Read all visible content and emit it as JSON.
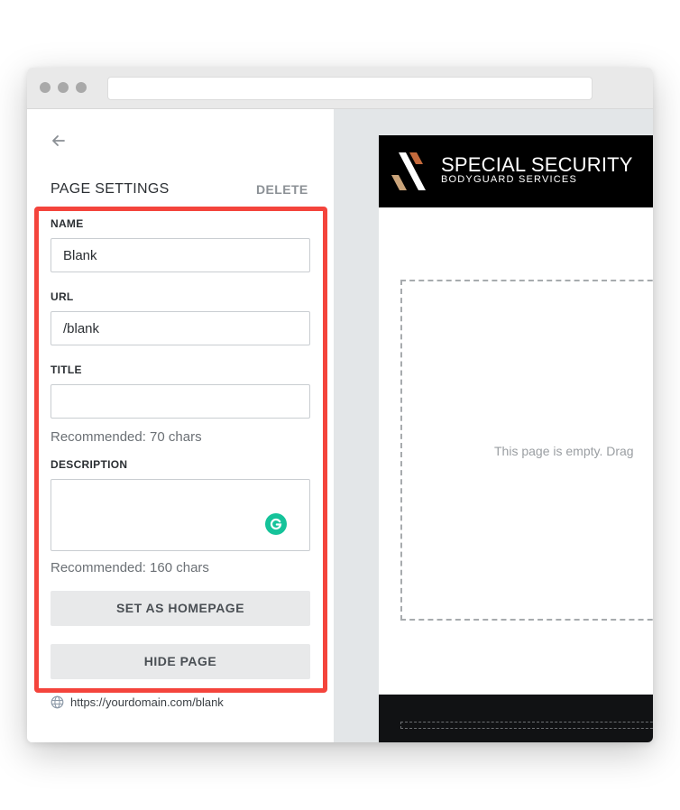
{
  "panel": {
    "title": "PAGE SETTINGS",
    "delete_label": "DELETE",
    "name_label": "NAME",
    "name_value": "Blank",
    "url_label": "URL",
    "url_value": "/blank",
    "title_label": "TITLE",
    "title_value": "",
    "title_hint": "Recommended: 70 chars",
    "description_label": "DESCRIPTION",
    "description_value": "",
    "description_hint": "Recommended: 160 chars",
    "homepage_button": "SET AS HOMEPAGE",
    "hide_button": "HIDE PAGE",
    "domain": "https://yourdomain.com/blank"
  },
  "preview": {
    "brand_line1": "SPECIAL SECURITY",
    "brand_line2": "BODYGUARD SERVICES",
    "empty_message": "This page is empty. Drag"
  },
  "colors": {
    "highlight": "#f4443c",
    "grammarly": "#15c39a",
    "logo_orange": "#c56a3c",
    "logo_tan": "#caa47a"
  },
  "icons": [
    "back-arrow-icon",
    "grammarly-icon",
    "globe-icon"
  ]
}
